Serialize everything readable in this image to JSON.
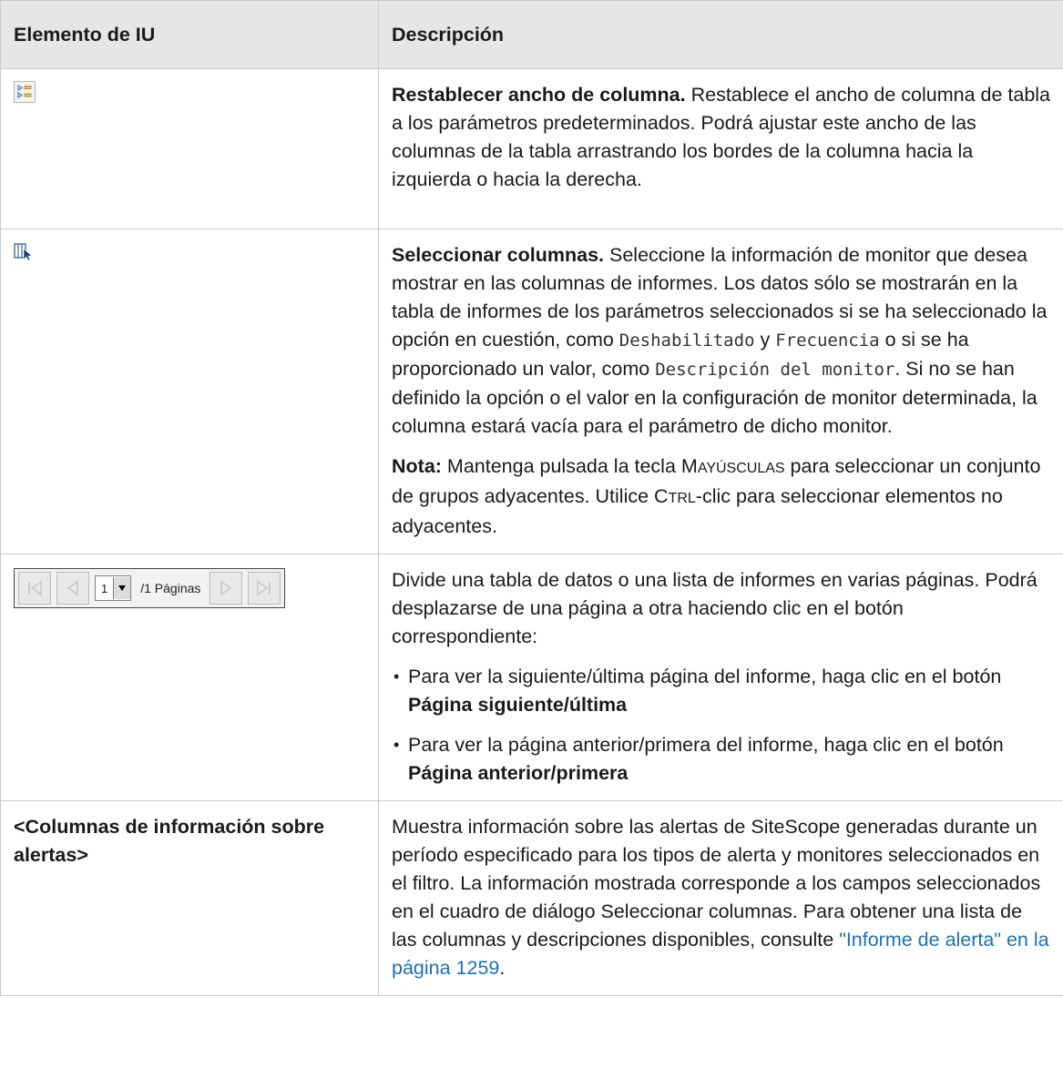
{
  "header": {
    "col1": "Elemento de IU",
    "col2": "Descripción"
  },
  "rows": [
    {
      "icon": "reset-column-width-icon",
      "title": "Restablecer ancho de columna.",
      "text": " Restablece el ancho de columna de tabla a los parámetros predeterminados. Podrá ajustar este ancho de las columnas de la tabla arrastrando los bordes de la columna hacia la izquierda o hacia la derecha."
    },
    {
      "icon": "select-columns-icon",
      "title": "Seleccionar columnas.",
      "text_a": " Seleccione la información de monitor que desea mostrar en las columnas de informes. Los datos sólo se mostrarán en la tabla de informes de los parámetros seleccionados si se ha seleccionado la opción en cuestión, como ",
      "code1": "Deshabilitado",
      "text_b": " y ",
      "code2": "Frecuencia",
      "text_c": " o si se ha proporcionado un valor, como ",
      "code3": "Descripción del monitor",
      "text_d": ". Si no se han definido la opción o el valor en la configuración de monitor determinada, la columna estará vacía para el parámetro de dicho monitor.",
      "note_label": "Nota:",
      "note_a": " Mantenga pulsada la tecla ",
      "key_shift_first": "M",
      "key_shift_rest": "AYÚSCULAS",
      "note_b": " para seleccionar un conjunto de grupos adyacentes. Utilice ",
      "key_ctrl_first": "C",
      "key_ctrl_rest": "TRL",
      "note_c": "-clic para seleccionar elementos no adyacentes."
    },
    {
      "pager": {
        "page_value": "1",
        "pages_label": "/1 Páginas"
      },
      "intro": "Divide una tabla de datos o una lista de informes en varias páginas. Podrá desplazarse de una página a otra haciendo clic en el botón correspondiente:",
      "bullets": [
        {
          "text": "Para ver la siguiente/última página del informe, haga clic en el botón ",
          "bold": "Página siguiente/última"
        },
        {
          "text": "Para ver la página anterior/primera del informe, haga clic en el botón ",
          "bold": "Página anterior/primera"
        }
      ]
    },
    {
      "label": "<Columnas de información sobre alertas>",
      "text": "Muestra información sobre las alertas de SiteScope generadas durante un período especificado para los tipos de alerta y monitores seleccionados en el filtro. La información mostrada corresponde a los campos seleccionados en el cuadro de diálogo Seleccionar columnas. Para obtener una lista de las columnas y descripciones disponibles, consulte ",
      "link": "\"Informe de alerta\" en la página 1259",
      "end": "."
    }
  ]
}
